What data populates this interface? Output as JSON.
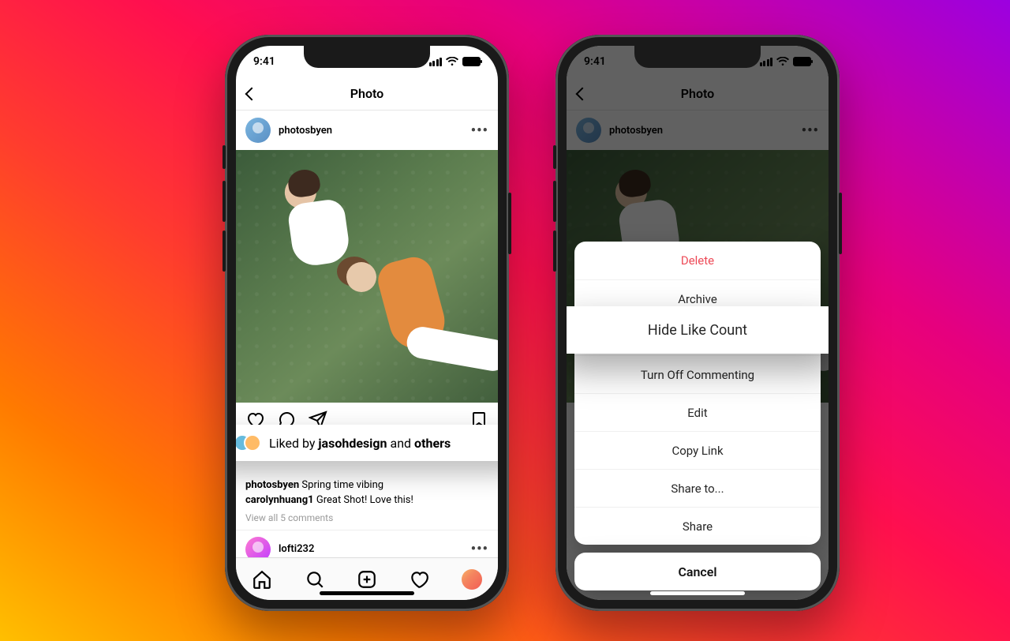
{
  "status": {
    "time": "9:41"
  },
  "nav": {
    "title": "Photo"
  },
  "post": {
    "username": "photosbyen",
    "liked_prefix": "Liked by ",
    "liked_user": "jasohdesign",
    "liked_middle": " and ",
    "liked_suffix": "others",
    "caption_user": "photosbyen",
    "caption_text": " Spring time vibing",
    "comment_user": "carolynhuang1",
    "comment_text": " Great Shot! Love this!",
    "view_all": "View all 5 comments"
  },
  "second_post": {
    "username": "lofti232"
  },
  "menu": {
    "items": [
      {
        "label": "Delete",
        "danger": true
      },
      {
        "label": "Archive",
        "danger": false
      },
      {
        "label": "Hide Like Count",
        "danger": false
      },
      {
        "label": "Turn Off Commenting",
        "danger": false
      },
      {
        "label": "Edit",
        "danger": false
      },
      {
        "label": "Copy Link",
        "danger": false
      },
      {
        "label": "Share to...",
        "danger": false
      },
      {
        "label": "Share",
        "danger": false
      }
    ],
    "cancel": "Cancel",
    "highlight": "Hide Like Count"
  }
}
